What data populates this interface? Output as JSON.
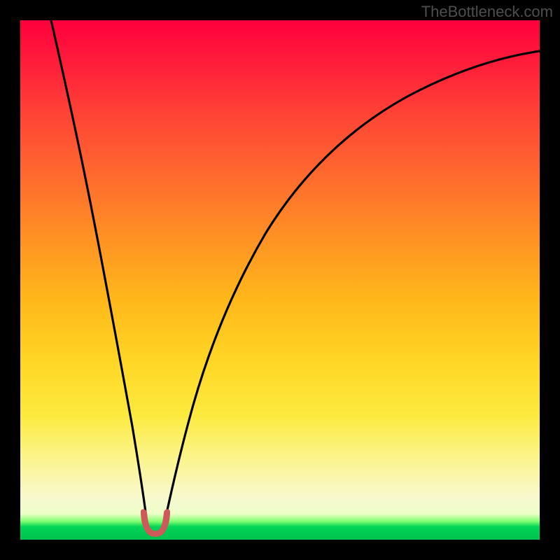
{
  "watermark": {
    "text": "TheBottleneck.com"
  },
  "colors": {
    "curve_stroke": "#000000",
    "blob_fill": "#cc5a5a",
    "blob_stroke": "#cc5a5a",
    "background": "#000000"
  },
  "chart_data": {
    "type": "line",
    "title": "",
    "xlabel": "",
    "ylabel": "",
    "xlim": [
      0,
      100
    ],
    "ylim": [
      0,
      100
    ],
    "grid": false,
    "legend": false,
    "note": "Axes have no visible tick labels; x/y values are estimated in percent of plot area. y=0 is the green band at the bottom; y=100 is the top.",
    "series": [
      {
        "name": "left-branch",
        "x": [
          6,
          8,
          10,
          12,
          14,
          16,
          18,
          20,
          22,
          23.5,
          24.5
        ],
        "values": [
          100,
          90,
          79,
          68,
          57,
          45,
          34,
          22,
          11,
          4,
          2
        ]
      },
      {
        "name": "right-branch",
        "x": [
          27.5,
          29,
          31,
          34,
          38,
          43,
          49,
          56,
          64,
          73,
          82,
          91,
          100
        ],
        "values": [
          2,
          4,
          10,
          19,
          30,
          41,
          51,
          60,
          68,
          75,
          81,
          86,
          90
        ]
      }
    ],
    "annotations": [
      {
        "name": "valley-blob",
        "shape": "u-blob",
        "approx_x_range": [
          23,
          29
        ],
        "approx_y_range": [
          1,
          4
        ],
        "color": "#cc5a5a"
      }
    ]
  }
}
